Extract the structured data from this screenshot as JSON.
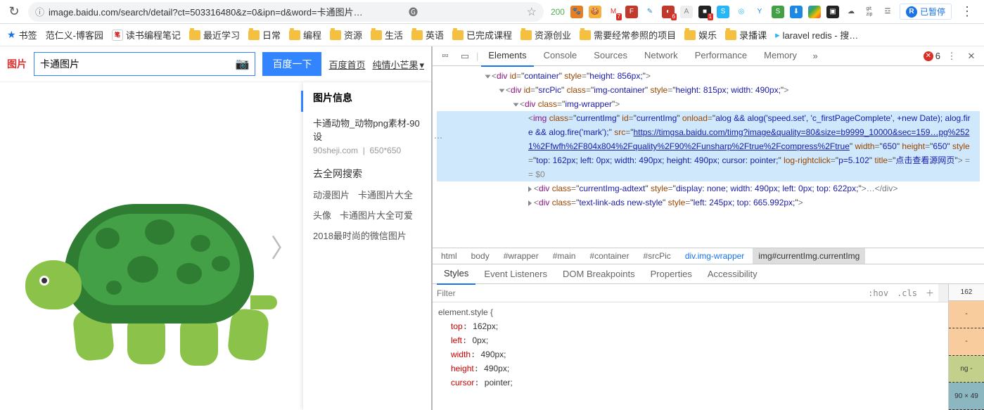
{
  "chrome": {
    "url_display": "image.baidu.com/search/detail?ct=503316480&z=0&ipn=d&word=卡通图片…",
    "ext_num": "200",
    "pause_letter": "R",
    "pause_label": "已暂停",
    "error_count": "6"
  },
  "bookmarks": [
    {
      "icon": "star",
      "label": "书签"
    },
    {
      "icon": "none",
      "label": "范仁义-博客园"
    },
    {
      "icon": "lj",
      "label": "读书编程笔记"
    },
    {
      "icon": "folder",
      "label": "最近学习"
    },
    {
      "icon": "folder",
      "label": "日常"
    },
    {
      "icon": "folder",
      "label": "编程"
    },
    {
      "icon": "folder",
      "label": "资源"
    },
    {
      "icon": "folder",
      "label": "生活"
    },
    {
      "icon": "folder",
      "label": "英语"
    },
    {
      "icon": "folder",
      "label": "已完成课程"
    },
    {
      "icon": "folder",
      "label": "资源创业"
    },
    {
      "icon": "folder",
      "label": "需要经常参照的项目"
    },
    {
      "icon": "folder",
      "label": "娱乐"
    },
    {
      "icon": "folder",
      "label": "录播课"
    },
    {
      "icon": "tv",
      "label": "laravel redis - 搜…"
    }
  ],
  "app": {
    "logo": "图片",
    "search_value": "卡通图片",
    "search_btn": "百度一下",
    "link_home": "百度首页",
    "link_mangguo": "纯情小芒果",
    "side_header": "图片信息",
    "side_img_title": "卡通动物_动物png素材-90设",
    "side_img_src_site": "90sheji.com",
    "side_img_size": "650*650",
    "side_goweb": "去全网搜索",
    "related": [
      "动漫图片",
      "卡通图片大全",
      "头像",
      "卡通图片大全可爱",
      "2018最时尚的微信图片"
    ]
  },
  "devtools_tabs": [
    "Elements",
    "Console",
    "Sources",
    "Network",
    "Performance",
    "Memory"
  ],
  "dom": {
    "line1": {
      "tag": "div",
      "a": [
        [
          "id",
          "container"
        ],
        [
          "style",
          "height: 856px;"
        ]
      ]
    },
    "line2": {
      "tag": "div",
      "a": [
        [
          "id",
          "srcPic"
        ],
        [
          "class",
          "img-container"
        ],
        [
          "style",
          "height: 815px; width: 490px;"
        ]
      ]
    },
    "line3": {
      "tag": "div",
      "a": [
        [
          "class",
          "img-wrapper"
        ]
      ]
    },
    "img_open": "<img ",
    "img_attrs_1": "class=\"currentImg\" id=\"currentImg\" onload=\"alog && alog('speed.set', 'c_firstPageComplete', +new Date); alog.fire && alog.fire('mark');\" src=\"",
    "img_url_1": "https://timgsa.baidu.com/timg?image&quality=80&size=b9999_10000&sec=159…pg%2521%2Ffwfh%2F804x804%2Fquality%2F90%2Funsharp%2Ftrue%2Fcompress%2Ftrue",
    "img_attrs_2_parts": [
      [
        "width",
        "650"
      ],
      [
        "height",
        "650"
      ],
      [
        "style",
        "top: 162px; left: 0px; width: 490px; height: 490px; cursor: pointer;"
      ],
      [
        "log-rightclick",
        "p=5.102"
      ],
      [
        "title",
        "点击查看源网页"
      ]
    ],
    "img_tail": " == $0",
    "line5": {
      "tag": "div",
      "a": [
        [
          "class",
          "currentImg-adtext"
        ],
        [
          "style",
          "display: none; width: 490px; left: 0px; top: 622px;"
        ]
      ],
      "tail": "…</div>"
    },
    "line6": {
      "tag": "div",
      "a": [
        [
          "class",
          "text-link-ads new-style"
        ],
        [
          "style",
          "left: 245px; top: 665.992px;"
        ]
      ]
    }
  },
  "crumbs": [
    "html",
    "body",
    "#wrapper",
    "#main",
    "#container",
    "#srcPic",
    "div.img-wrapper",
    "img#currentImg.currentImg"
  ],
  "style_tabs": [
    "Styles",
    "Event Listeners",
    "DOM Breakpoints",
    "Properties",
    "Accessibility"
  ],
  "filter_placeholder": "Filter",
  "hov": ":hov",
  "cls": ".cls",
  "css": {
    "selector": "element.style {",
    "props": [
      [
        "top",
        "162px;"
      ],
      [
        "left",
        "0px;"
      ],
      [
        "width",
        "490px;"
      ],
      [
        "height",
        "490px;"
      ],
      [
        "cursor",
        "pointer;"
      ]
    ]
  },
  "boxmodel": {
    "top_num": "162",
    "dash": "-",
    "pad": "-",
    "ng": "ng -",
    "size": "90 × 49"
  }
}
